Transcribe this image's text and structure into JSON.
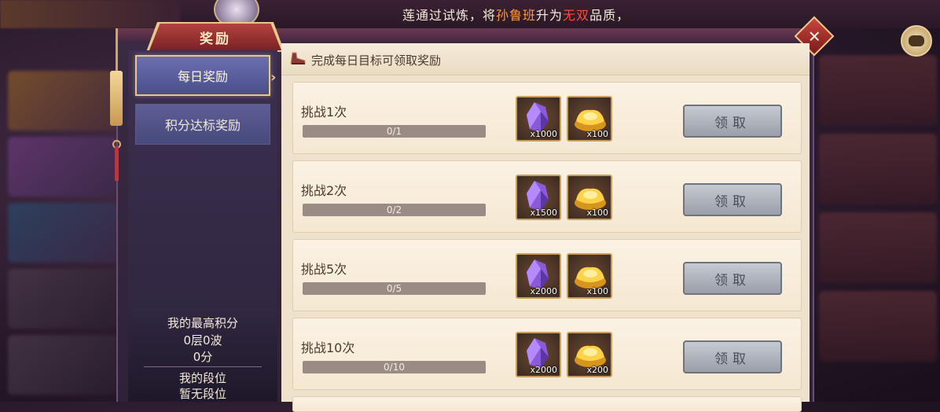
{
  "broadcast": {
    "pre": "莲通过试炼，将",
    "hero": "孙鲁班",
    "mid": "升为",
    "quality": "无双",
    "post": "品质，"
  },
  "dialog": {
    "title": "奖励",
    "content_title": "完成每日目标可领取奖励"
  },
  "sidebar": {
    "tabs": [
      {
        "label": "每日奖励",
        "active": true
      },
      {
        "label": "积分达标奖励",
        "active": false
      }
    ],
    "best_score_label": "我的最高积分",
    "best_score_waves": "0层0波",
    "best_score_points": "0分",
    "rank_label": "我的段位",
    "rank_value": "暂无段位"
  },
  "rewards": [
    {
      "title": "挑战1次",
      "progress": "0/1",
      "progress_fraction": 0,
      "crystal_count": "x1000",
      "gold_count": "x100",
      "claim_label": "领取"
    },
    {
      "title": "挑战2次",
      "progress": "0/2",
      "progress_fraction": 0,
      "crystal_count": "x1500",
      "gold_count": "x100",
      "claim_label": "领取"
    },
    {
      "title": "挑战5次",
      "progress": "0/5",
      "progress_fraction": 0,
      "crystal_count": "x2000",
      "gold_count": "x100",
      "claim_label": "领取"
    },
    {
      "title": "挑战10次",
      "progress": "0/10",
      "progress_fraction": 0,
      "crystal_count": "x2000",
      "gold_count": "x200",
      "claim_label": "领取"
    }
  ],
  "icons": {
    "close": "close-icon",
    "chat": "chat-icon",
    "crystal": "purple-crystal-icon",
    "gold": "gold-ingot-icon",
    "shoe": "shoe-icon"
  },
  "colors": {
    "accent_gold": "#e7c78c",
    "title_red": "#b2433f",
    "hero_orange": "#ff9a3a",
    "quality_red": "#ff4a3a",
    "claim_disabled": "#9a9ea8"
  }
}
